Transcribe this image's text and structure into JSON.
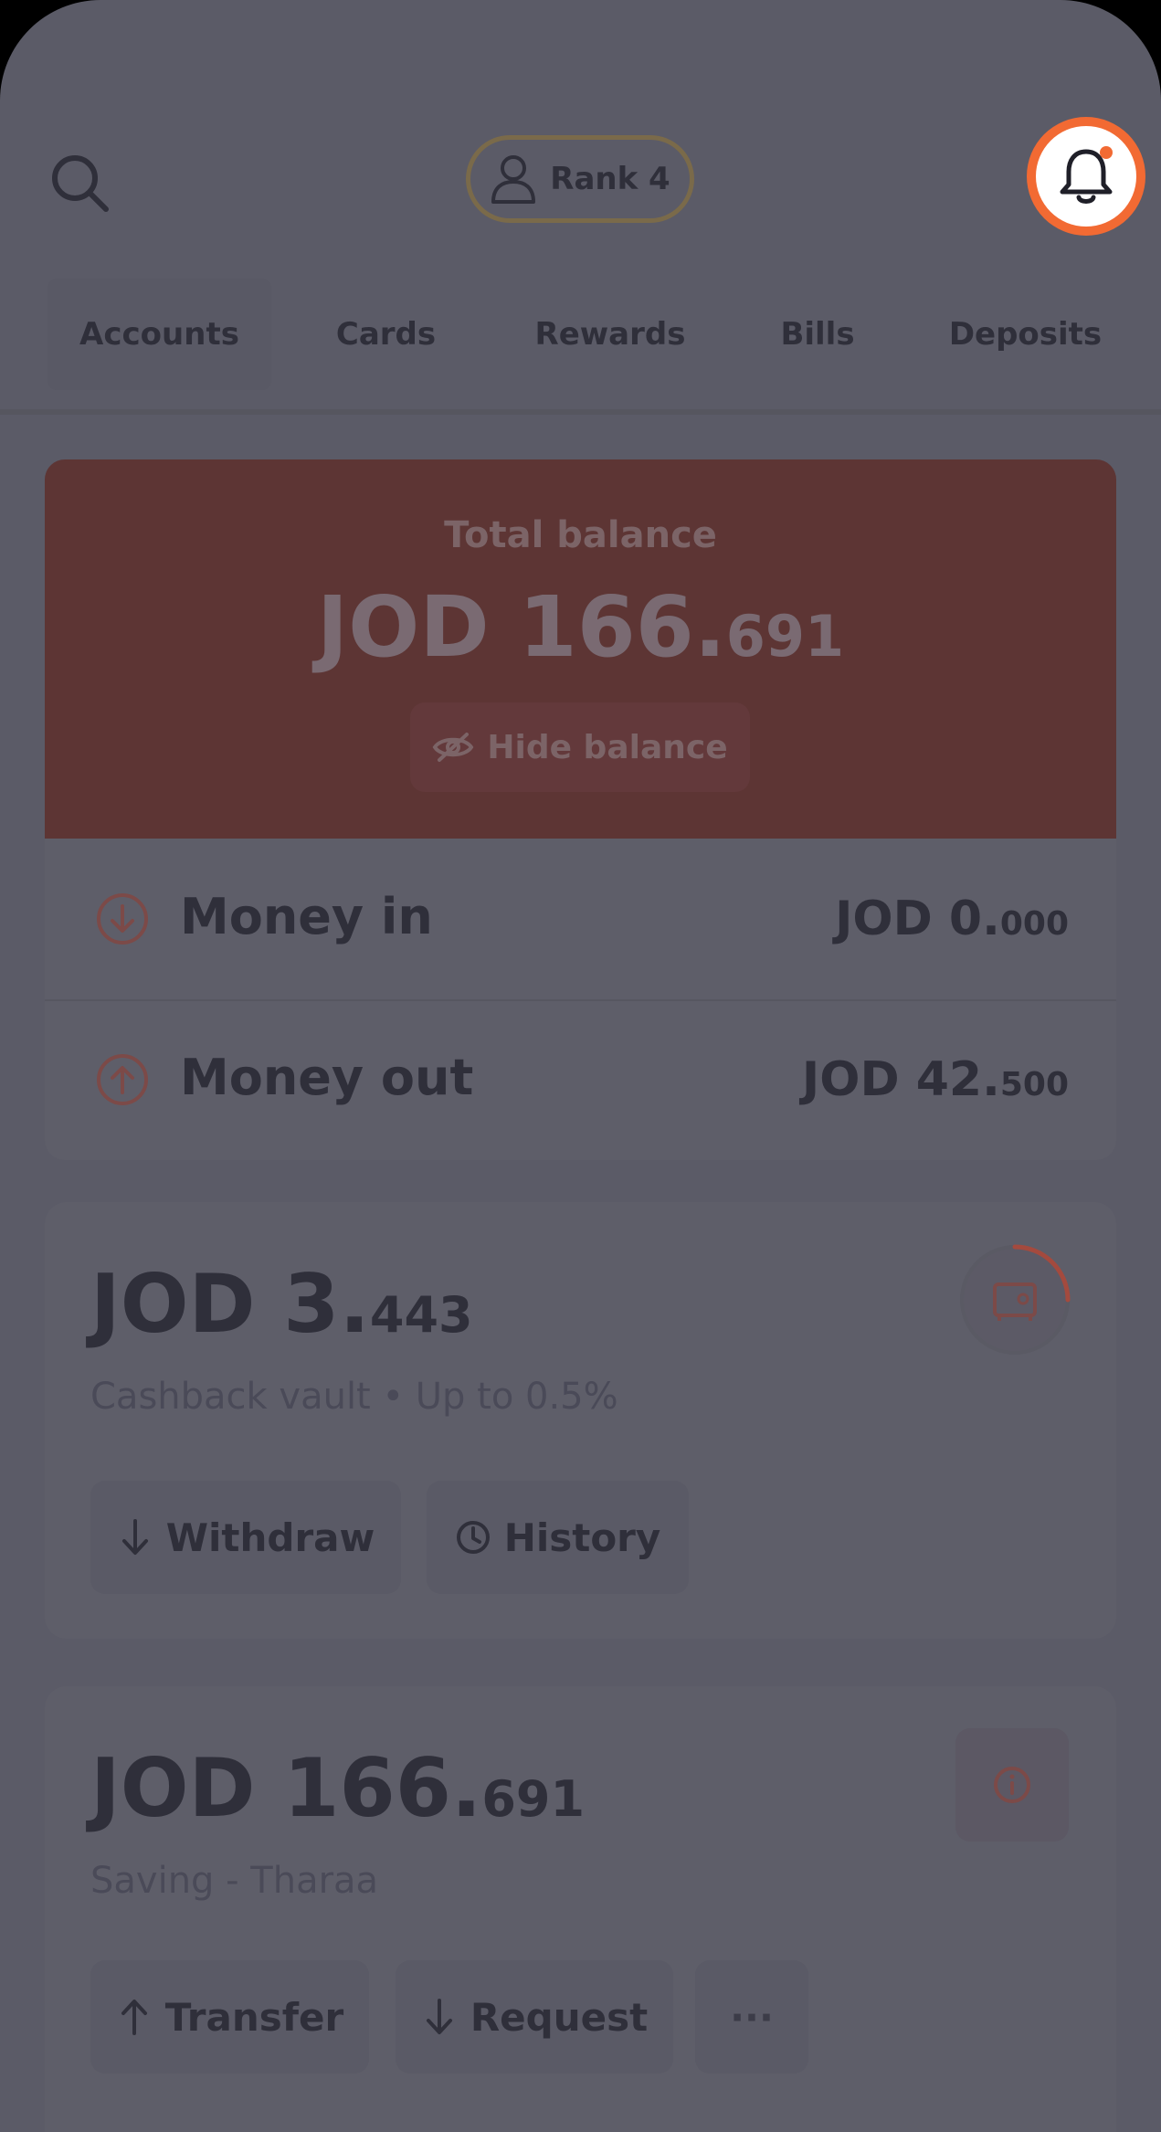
{
  "header": {
    "rank_label": "Rank 4"
  },
  "tabs": [
    {
      "label": "Accounts",
      "active": true
    },
    {
      "label": "Cards",
      "active": false
    },
    {
      "label": "Rewards",
      "active": false
    },
    {
      "label": "Bills",
      "active": false
    },
    {
      "label": "Deposits",
      "active": false
    }
  ],
  "balance": {
    "label": "Total balance",
    "amount_main": "JOD 166.",
    "amount_decimals": "691",
    "hide_label": "Hide balance"
  },
  "flows": {
    "money_in": {
      "label": "Money in",
      "value_main": "JOD 0.",
      "value_decimals": "000"
    },
    "money_out": {
      "label": "Money out",
      "value_main": "JOD 42.",
      "value_decimals": "500"
    }
  },
  "vault": {
    "amount_main": "JOD 3.",
    "amount_decimals": "443",
    "subtitle": "Cashback vault • Up to 0.5%",
    "withdraw_label": "Withdraw",
    "history_label": "History"
  },
  "saving": {
    "amount_main": "JOD 166.",
    "amount_decimals": "691",
    "subtitle": "Saving - Tharaa",
    "transfer_label": "Transfer",
    "request_label": "Request",
    "more_label": "···"
  },
  "colors": {
    "accent": "#f26a33",
    "overlay": "#5b5b67",
    "text_dark": "#2f2f3a"
  }
}
